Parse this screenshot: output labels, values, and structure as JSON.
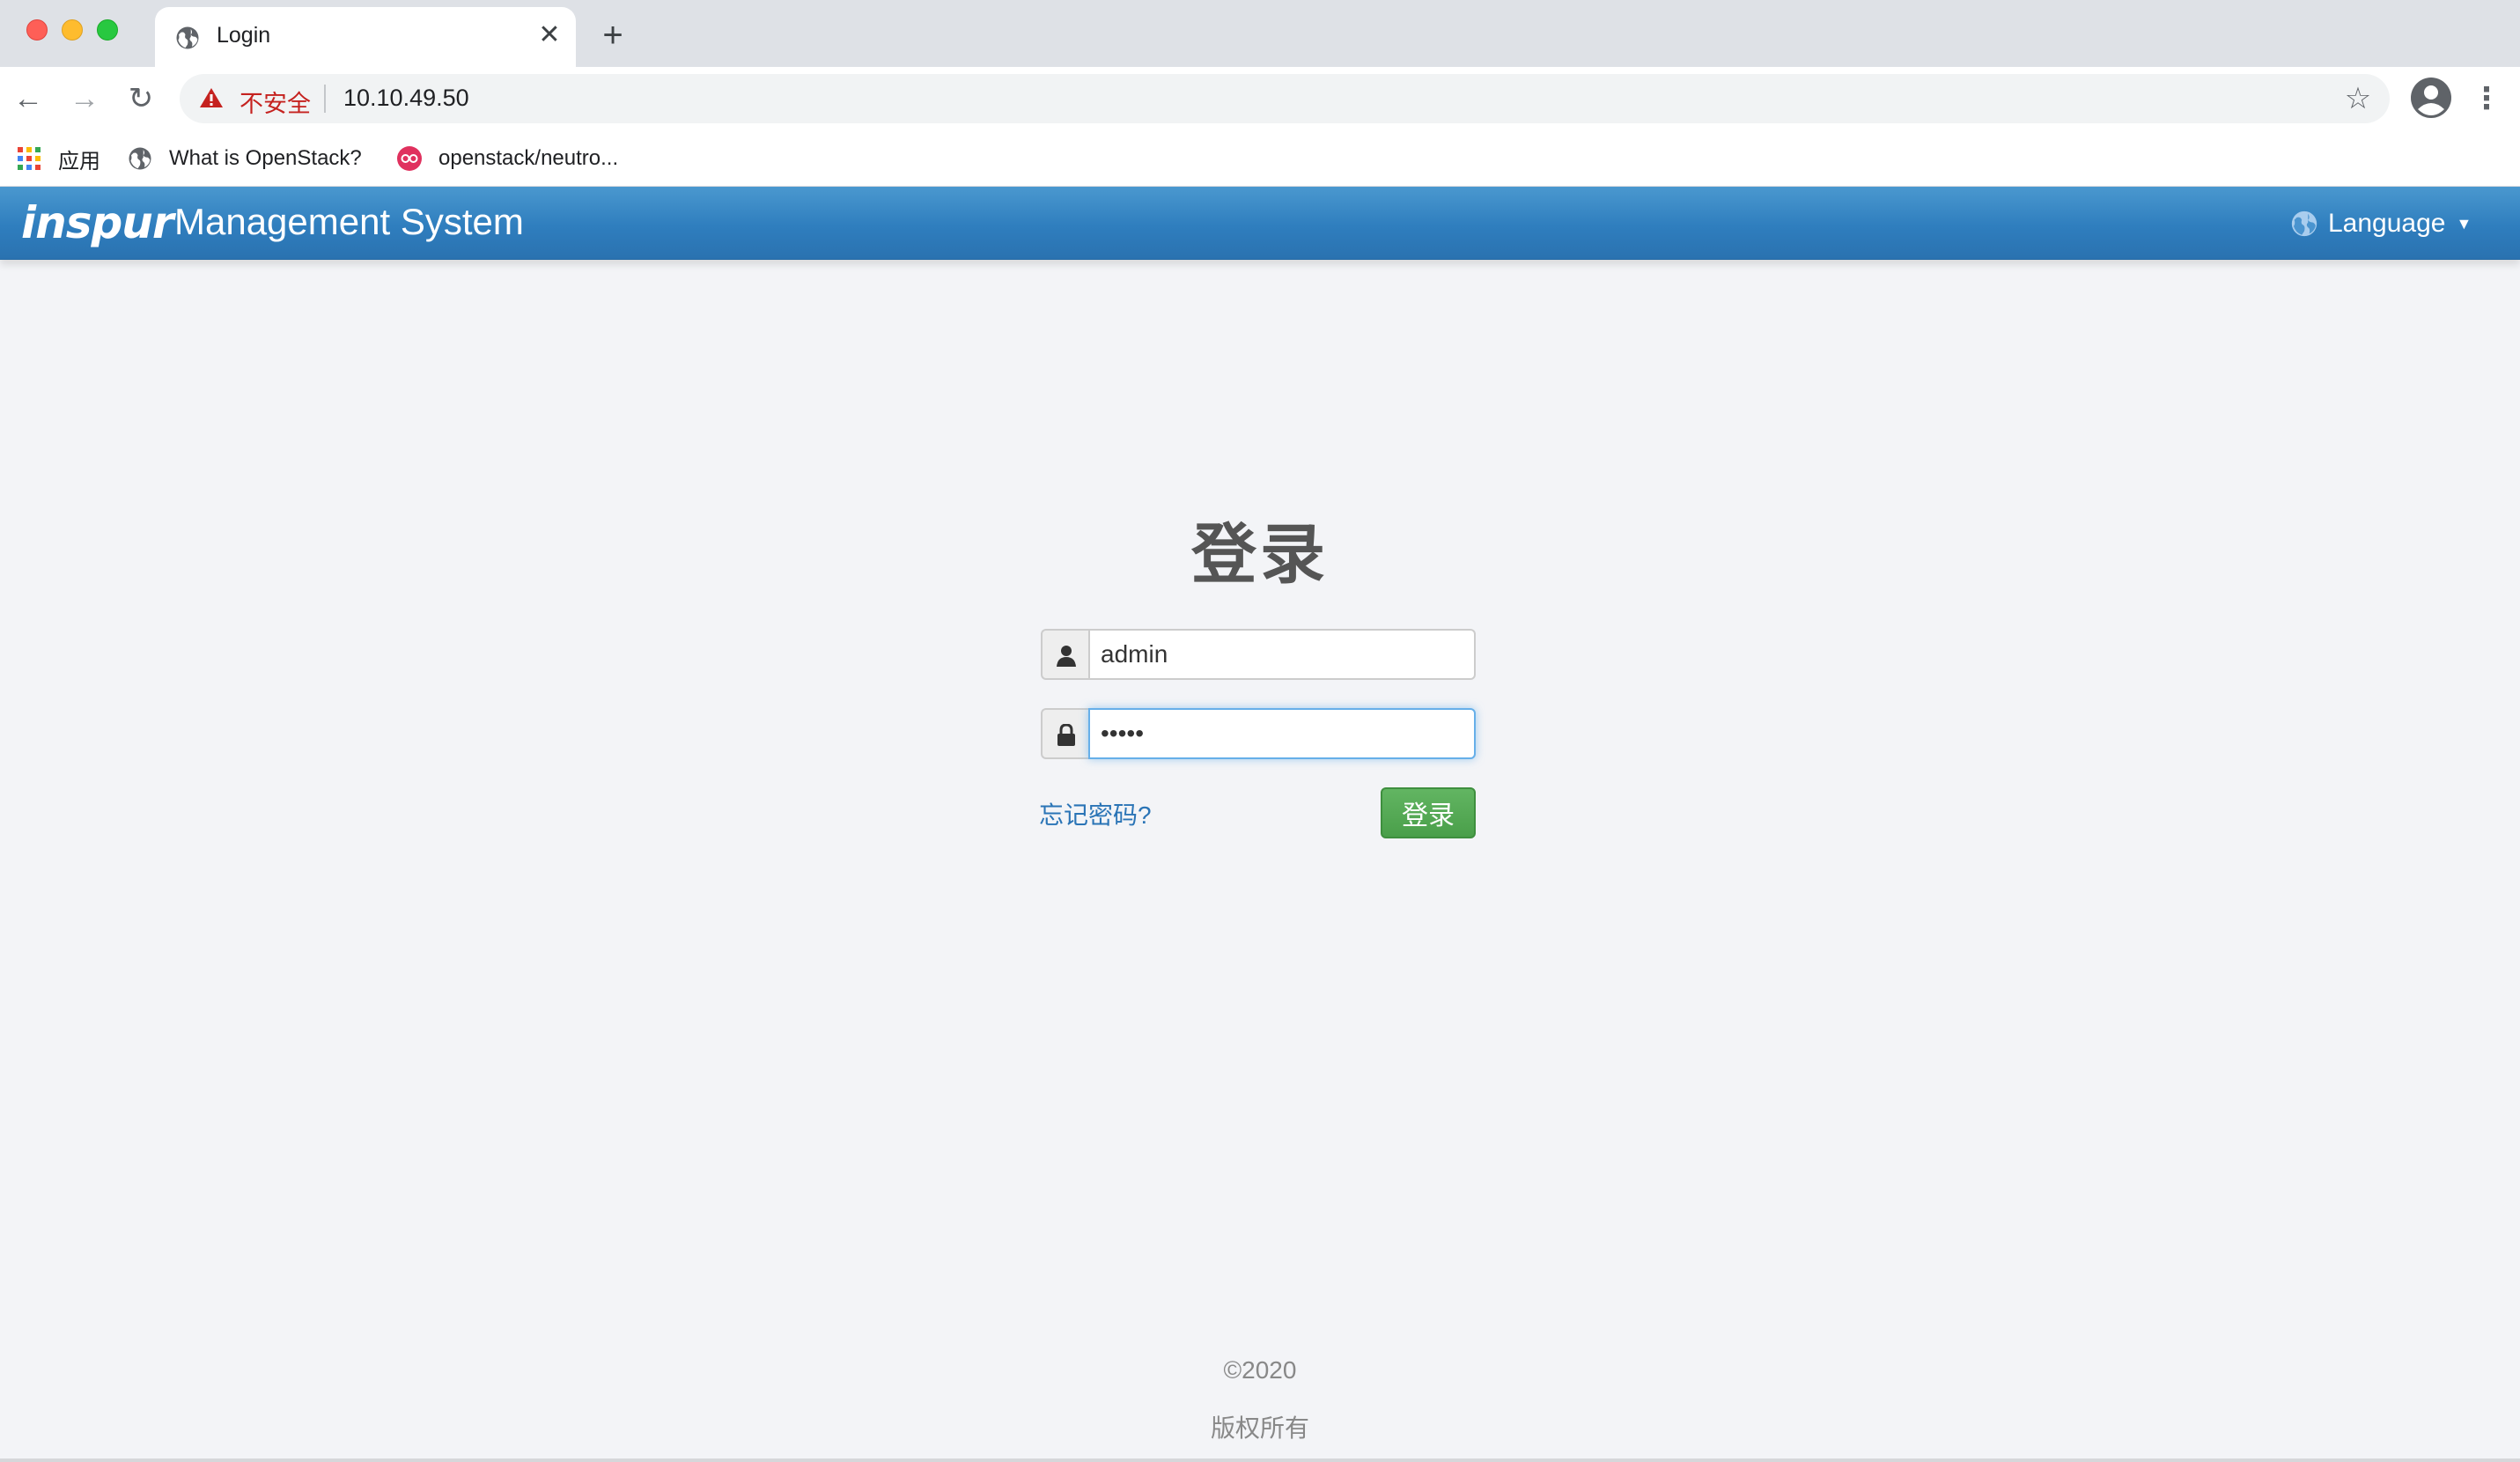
{
  "browser": {
    "tab_title": "Login",
    "new_tab_glyph": "+",
    "close_glyph": "✕",
    "security_label": "不安全",
    "url": "10.10.49.50",
    "bookmarks": [
      {
        "label": "应用",
        "icon": "apps-grid-icon"
      },
      {
        "label": "What is OpenStack?",
        "icon": "globe-icon"
      },
      {
        "label": "openstack/neutro...",
        "icon": "github-icon"
      }
    ]
  },
  "header": {
    "brand_logo": "inspur",
    "brand_name": "Management System",
    "language_label": "Language"
  },
  "login": {
    "title": "登录",
    "username_value": "admin",
    "password_value": "•••••",
    "forgot_label": "忘记密码?",
    "submit_label": "登录"
  },
  "footer": {
    "copyright": "©2020",
    "rights": "版权所有"
  },
  "colors": {
    "header_blue": "#2f7ebe",
    "login_green": "#4a9f4a",
    "link_blue": "#2a74b6",
    "insecure_red": "#c5221f"
  }
}
